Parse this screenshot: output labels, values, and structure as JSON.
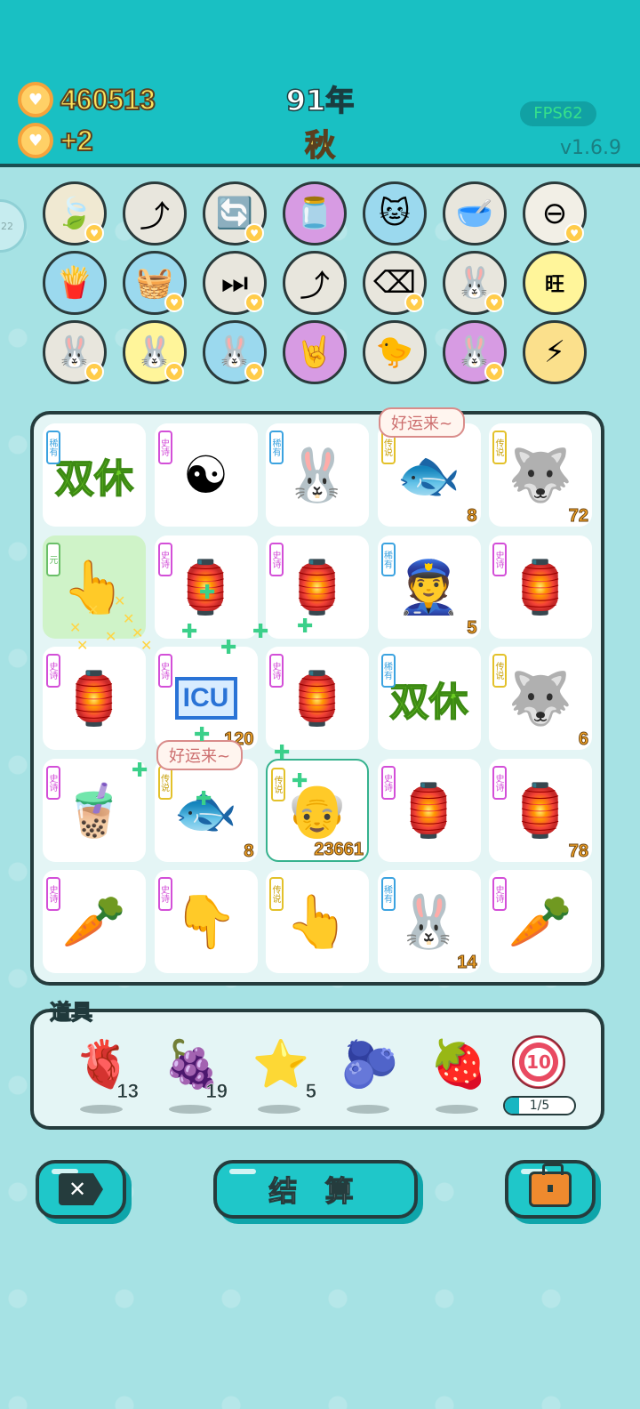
{
  "header": {
    "coins": "460513",
    "coin_gain": "+2",
    "year": "91年",
    "season": "秋",
    "fps": "FPS62",
    "version": "v1.6.9",
    "side_badge": "22"
  },
  "skills": [
    {
      "name": "leaf",
      "icon": "🍃",
      "bg": "#f0e9d2",
      "heart": true
    },
    {
      "name": "upgrade-arrow",
      "icon": "⤴",
      "bg": "#e8e6dd",
      "heart": false
    },
    {
      "name": "refresh",
      "icon": "🔄",
      "bg": "#e8e6dd",
      "heart": true
    },
    {
      "name": "jar",
      "icon": "🫙",
      "bg": "#d79be3",
      "heart": false
    },
    {
      "name": "cat",
      "icon": "🐱",
      "bg": "#9bd9ee",
      "heart": false
    },
    {
      "name": "pet-bowl",
      "icon": "🥣",
      "bg": "#e8e6dd",
      "heart": false
    },
    {
      "name": "minus",
      "icon": "⊖",
      "bg": "#f2efe6",
      "heart": true
    },
    {
      "name": "fries",
      "icon": "🍟",
      "bg": "#9bd9ee",
      "heart": false
    },
    {
      "name": "fruit-basket",
      "icon": "🧺",
      "bg": "#9bd9ee",
      "heart": true
    },
    {
      "name": "skip",
      "icon": "⏭",
      "bg": "#e8e6dd",
      "heart": true
    },
    {
      "name": "upgrade-arrow-2",
      "icon": "⤴",
      "bg": "#e8e6dd",
      "heart": false
    },
    {
      "name": "delete",
      "icon": "⌫",
      "bg": "#e8e6dd",
      "heart": true
    },
    {
      "name": "rabbit",
      "icon": "🐰",
      "bg": "#e8e6dd",
      "heart": true
    },
    {
      "name": "wang",
      "icon": "旺",
      "bg": "#fff59a",
      "heart": false
    },
    {
      "name": "rabbit-2",
      "icon": "🐰",
      "bg": "#e8e6dd",
      "heart": true
    },
    {
      "name": "rabbit-3",
      "icon": "🐰",
      "bg": "#fff59a",
      "heart": true
    },
    {
      "name": "rabbit-4",
      "icon": "🐰",
      "bg": "#9bd9ee",
      "heart": true
    },
    {
      "name": "rock-hand",
      "icon": "🤘",
      "bg": "#d79be3",
      "heart": false
    },
    {
      "name": "chick",
      "icon": "🐤",
      "bg": "#e8e6dd",
      "heart": false
    },
    {
      "name": "rabbit-5",
      "icon": "🐰",
      "bg": "#d79be3",
      "heart": true
    },
    {
      "name": "lightning",
      "icon": "⚡",
      "bg": "#fbe08c",
      "heart": false
    }
  ],
  "board": {
    "tags": {
      "rare": "稀有",
      "epic": "史诗",
      "legend": "传说",
      "yuan": "元"
    },
    "bubble_text": "好运来~",
    "cells": [
      {
        "tag": "rare",
        "item": "double-rest",
        "text": "双休",
        "num": ""
      },
      {
        "tag": "epic",
        "item": "bagua",
        "icon": "☯",
        "num": ""
      },
      {
        "tag": "rare",
        "item": "rabbit",
        "icon": "🐰",
        "num": ""
      },
      {
        "tag": "legend",
        "item": "koi",
        "icon": "🐟",
        "num": "8"
      },
      {
        "tag": "legend",
        "item": "husky-king",
        "icon": "🐺",
        "num": "72"
      },
      {
        "tag": "yuan",
        "item": "golden-finger",
        "icon": "👆",
        "num": ""
      },
      {
        "tag": "epic",
        "item": "rabbit-house",
        "icon": "🏮",
        "num": ""
      },
      {
        "tag": "epic",
        "item": "rabbit-house",
        "icon": "🏮",
        "num": ""
      },
      {
        "tag": "rare",
        "item": "police",
        "icon": "👮",
        "num": "5"
      },
      {
        "tag": "epic",
        "item": "rabbit-house",
        "icon": "🏮",
        "num": ""
      },
      {
        "tag": "epic",
        "item": "rabbit-house",
        "icon": "🏮",
        "num": ""
      },
      {
        "tag": "epic",
        "item": "icu",
        "text": "ICU",
        "num": "120"
      },
      {
        "tag": "epic",
        "item": "rabbit-house",
        "icon": "🏮",
        "num": ""
      },
      {
        "tag": "rare",
        "item": "double-rest",
        "text": "双休",
        "num": ""
      },
      {
        "tag": "legend",
        "item": "husky-king",
        "icon": "🐺",
        "num": "6"
      },
      {
        "tag": "epic",
        "item": "bubble-tea",
        "icon": "🧋",
        "num": ""
      },
      {
        "tag": "legend",
        "item": "koi",
        "icon": "🐟",
        "num": "8"
      },
      {
        "tag": "legend",
        "item": "old-man",
        "icon": "👴",
        "num": "23661"
      },
      {
        "tag": "epic",
        "item": "rabbit-house",
        "icon": "🏮",
        "num": ""
      },
      {
        "tag": "epic",
        "item": "rabbit-house",
        "icon": "🏮",
        "num": "78"
      },
      {
        "tag": "epic",
        "item": "carrot",
        "icon": "🥕",
        "num": ""
      },
      {
        "tag": "epic",
        "item": "silver-finger",
        "icon": "👇",
        "num": ""
      },
      {
        "tag": "legend",
        "item": "golden-finger",
        "icon": "👆",
        "num": ""
      },
      {
        "tag": "rare",
        "item": "rabbit",
        "icon": "🐰",
        "num": "14"
      },
      {
        "tag": "epic",
        "item": "carrot",
        "icon": "🥕",
        "num": ""
      }
    ]
  },
  "items_panel": {
    "title": "道具",
    "items": [
      {
        "name": "liver",
        "icon": "🫀",
        "count": "13"
      },
      {
        "name": "waxberry",
        "icon": "🍇",
        "count": "19"
      },
      {
        "name": "star",
        "icon": "⭐",
        "count": "5"
      },
      {
        "name": "blueberry",
        "icon": "🫐",
        "count": ""
      },
      {
        "name": "strawberry",
        "icon": "🍓",
        "count": ""
      }
    ],
    "target": {
      "value": "10",
      "progress_label": "1/5",
      "progress_fraction": 0.2
    }
  },
  "buttons": {
    "settle": "结 算",
    "cancel_icon": "✕"
  }
}
